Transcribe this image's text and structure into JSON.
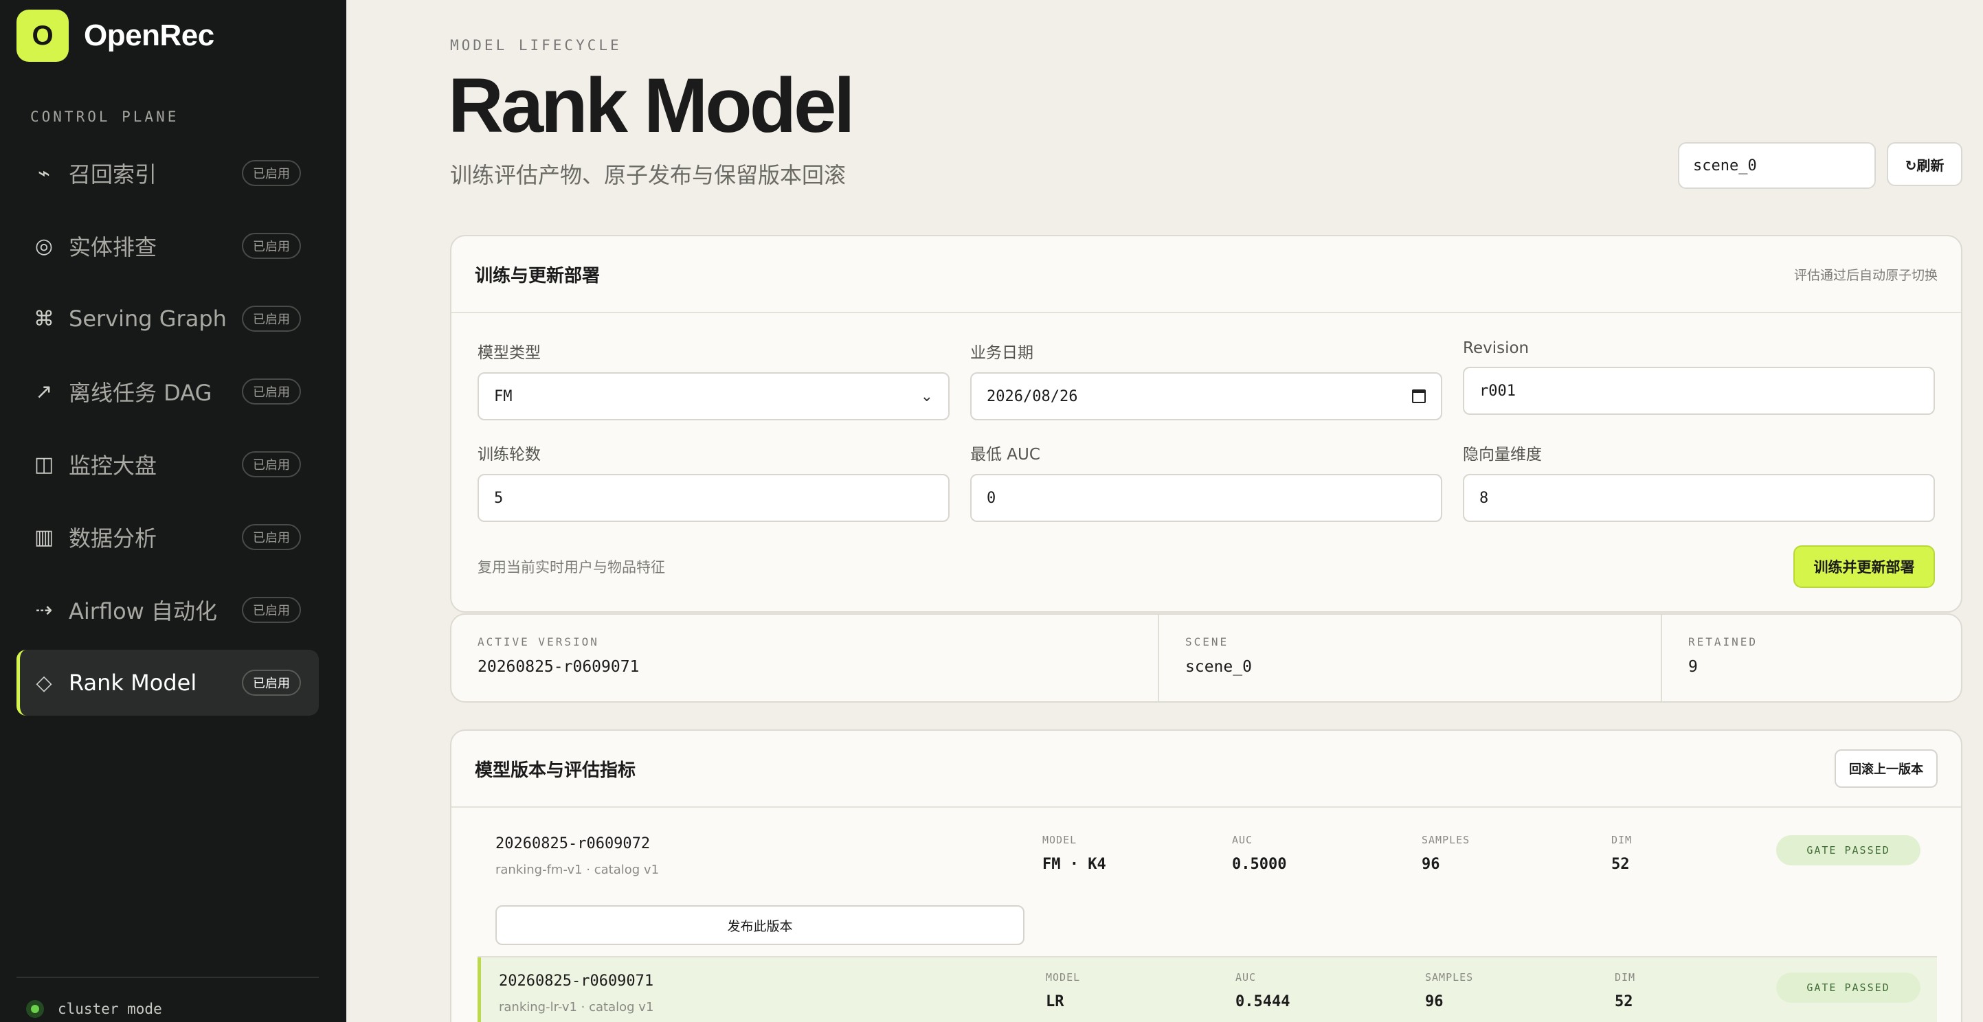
{
  "sidebar": {
    "brand_letter": "O",
    "brand_name": "OpenRec",
    "section_label": "CONTROL PLANE",
    "items": [
      {
        "icon": "⌁",
        "icon_name": "recall-index-icon",
        "label": "召回索引",
        "badge": "已启用"
      },
      {
        "icon": "◎",
        "icon_name": "entity-inspect-icon",
        "label": "实体排查",
        "badge": "已启用"
      },
      {
        "icon": "⌘",
        "icon_name": "serving-graph-icon",
        "label": "Serving Graph",
        "badge": "已启用"
      },
      {
        "icon": "↗",
        "icon_name": "offline-dag-icon",
        "label": "离线任务 DAG",
        "badge": "已启用"
      },
      {
        "icon": "◫",
        "icon_name": "monitor-dashboard-icon",
        "label": "监控大盘",
        "badge": "已启用"
      },
      {
        "icon": "▥",
        "icon_name": "data-analysis-icon",
        "label": "数据分析",
        "badge": "已启用"
      },
      {
        "icon": "⇢",
        "icon_name": "airflow-icon",
        "label": "Airflow 自动化",
        "badge": "已启用"
      },
      {
        "icon": "◇",
        "icon_name": "rank-model-icon",
        "label": "Rank Model",
        "badge": "已启用",
        "active": true
      }
    ],
    "cluster_text": "cluster mode"
  },
  "header": {
    "eyebrow": "MODEL LIFECYCLE",
    "title": "Rank Model",
    "subtitle": "训练评估产物、原子发布与保留版本回滚",
    "scene_value": "scene_0",
    "refresh_label": "↻刷新"
  },
  "train": {
    "title": "训练与更新部署",
    "hint": "评估通过后自动原子切换",
    "fields": {
      "model_type": {
        "label": "模型类型",
        "value": "FM"
      },
      "biz_date": {
        "label": "业务日期",
        "value": "2026/08/26"
      },
      "revision": {
        "label": "Revision",
        "value": "r001"
      },
      "epochs": {
        "label": "训练轮数",
        "value": "5"
      },
      "min_auc": {
        "label": "最低 AUC",
        "value": "0"
      },
      "latent_dim": {
        "label": "隐向量维度",
        "value": "8"
      }
    },
    "note": "复用当前实时用户与物品特征",
    "submit_label": "训练并更新部署"
  },
  "stats": {
    "active_version": {
      "label": "ACTIVE VERSION",
      "value": "20260825-r0609071"
    },
    "scene": {
      "label": "SCENE",
      "value": "scene_0"
    },
    "retained": {
      "label": "RETAINED",
      "value": "9"
    }
  },
  "versions": {
    "title": "模型版本与评估指标",
    "rollback_label": "回滚上一版本",
    "metric_labels": {
      "model": "MODEL",
      "auc": "AUC",
      "samples": "SAMPLES",
      "dim": "DIM"
    },
    "rows": [
      {
        "id": "20260825-r0609072",
        "desc": "ranking-fm-v1 · catalog v1",
        "model": "FM · K4",
        "auc": "0.5000",
        "samples": "96",
        "dim": "52",
        "gate": "GATE PASSED",
        "publish_label": "发布此版本"
      },
      {
        "id": "20260825-r0609071",
        "desc": "ranking-lr-v1 · catalog v1",
        "model": "LR",
        "auc": "0.5444",
        "samples": "96",
        "dim": "52",
        "gate": "GATE PASSED"
      }
    ]
  },
  "colors": {
    "accent": "#d6f54a",
    "sidebar_bg": "#171818",
    "page_bg": "#f2efe8",
    "gate_bg": "#e2f0d2",
    "gate_text": "#3f6b35"
  }
}
